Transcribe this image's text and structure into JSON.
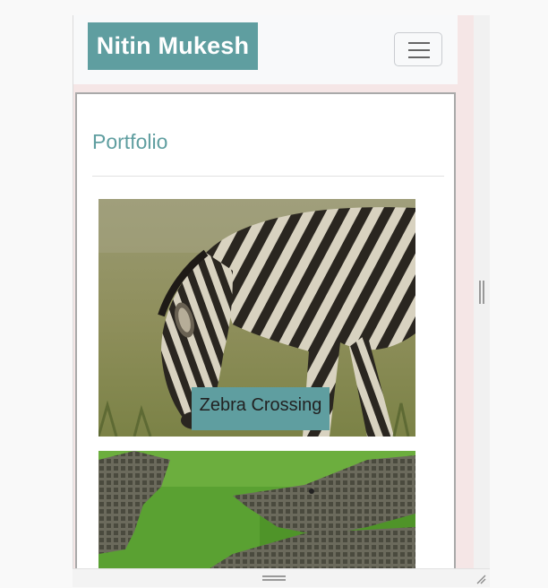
{
  "navbar": {
    "brand": "Nitin Mukesh"
  },
  "page": {
    "heading": "Portfolio"
  },
  "portfolio": {
    "items": [
      {
        "caption": "Zebra Crossing",
        "image": "zebra grazing on grass"
      },
      {
        "caption": "",
        "image": "crocodiles resting on grass"
      }
    ]
  },
  "colors": {
    "accent": "#5f9ea0",
    "navbar_bg": "#f8f9fa"
  }
}
